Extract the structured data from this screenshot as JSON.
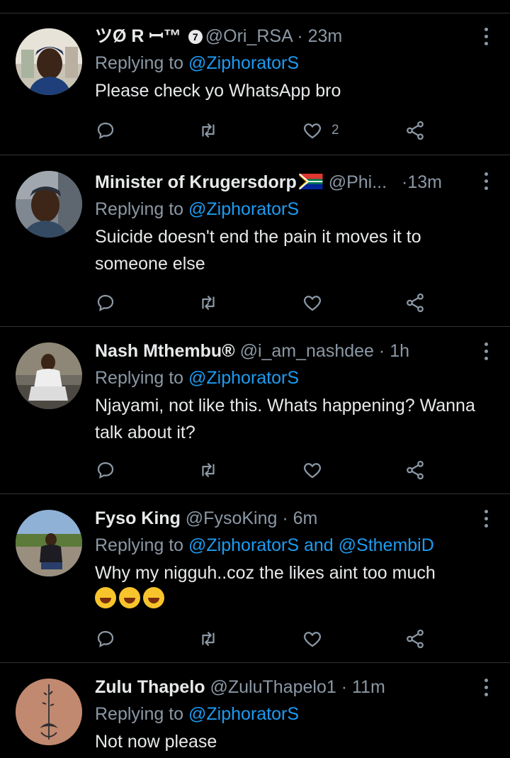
{
  "tweets": [
    {
      "name": "ツØ R ꟷ™",
      "handle": "@Ori_RSA",
      "dot": "·",
      "time": "23m",
      "replying_prefix": "Replying to ",
      "mention": "@ZiphoratorS",
      "mention_join": "",
      "mention2": "",
      "text": "Please check yo WhatsApp bro",
      "likes": "2",
      "badge": "7",
      "flag": false,
      "emojis": 0
    },
    {
      "name": "Minister of Krugersdorp",
      "handle": "@Phi...",
      "dot": "·",
      "time": "13m",
      "replying_prefix": "Replying to ",
      "mention": "@ZiphoratorS",
      "mention_join": "",
      "mention2": "",
      "text": "Suicide doesn't end the pain it moves it to someone else",
      "likes": "",
      "badge": "",
      "flag": true,
      "emojis": 0
    },
    {
      "name": "Nash Mthembu®",
      "handle": "@i_am_nashdee",
      "dot": "·",
      "time": "1h",
      "replying_prefix": "Replying to ",
      "mention": "@ZiphoratorS",
      "mention_join": "",
      "mention2": "",
      "text": "Njayami, not like this. Whats happening? Wanna talk about it?",
      "likes": "",
      "badge": "",
      "flag": false,
      "emojis": 0
    },
    {
      "name": "Fyso King",
      "handle": "@FysoKing",
      "dot": "·",
      "time": "6m",
      "replying_prefix": "Replying to ",
      "mention": "@ZiphoratorS",
      "mention_join": " and ",
      "mention2": "@SthembiD",
      "text": "Why my nigguh..coz the likes aint too much",
      "likes": "",
      "badge": "",
      "flag": false,
      "emojis": 3
    },
    {
      "name": "Zulu Thapelo",
      "handle": "@ZuluThapelo1",
      "dot": "·",
      "time": "11m",
      "replying_prefix": "Replying to ",
      "mention": "@ZiphoratorS",
      "mention_join": "",
      "mention2": "",
      "text": "Not now please",
      "likes": "",
      "badge": "",
      "flag": false,
      "emojis": 0
    }
  ],
  "icons": {
    "reply": "reply-icon",
    "retweet": "retweet-icon",
    "like": "heart-icon",
    "share": "share-icon",
    "more": "more-options-icon"
  },
  "colors": {
    "background": "#000000",
    "text": "#e7e9ea",
    "secondary": "#8b98a5",
    "link": "#1d9bf0",
    "divider": "#2f3336"
  }
}
